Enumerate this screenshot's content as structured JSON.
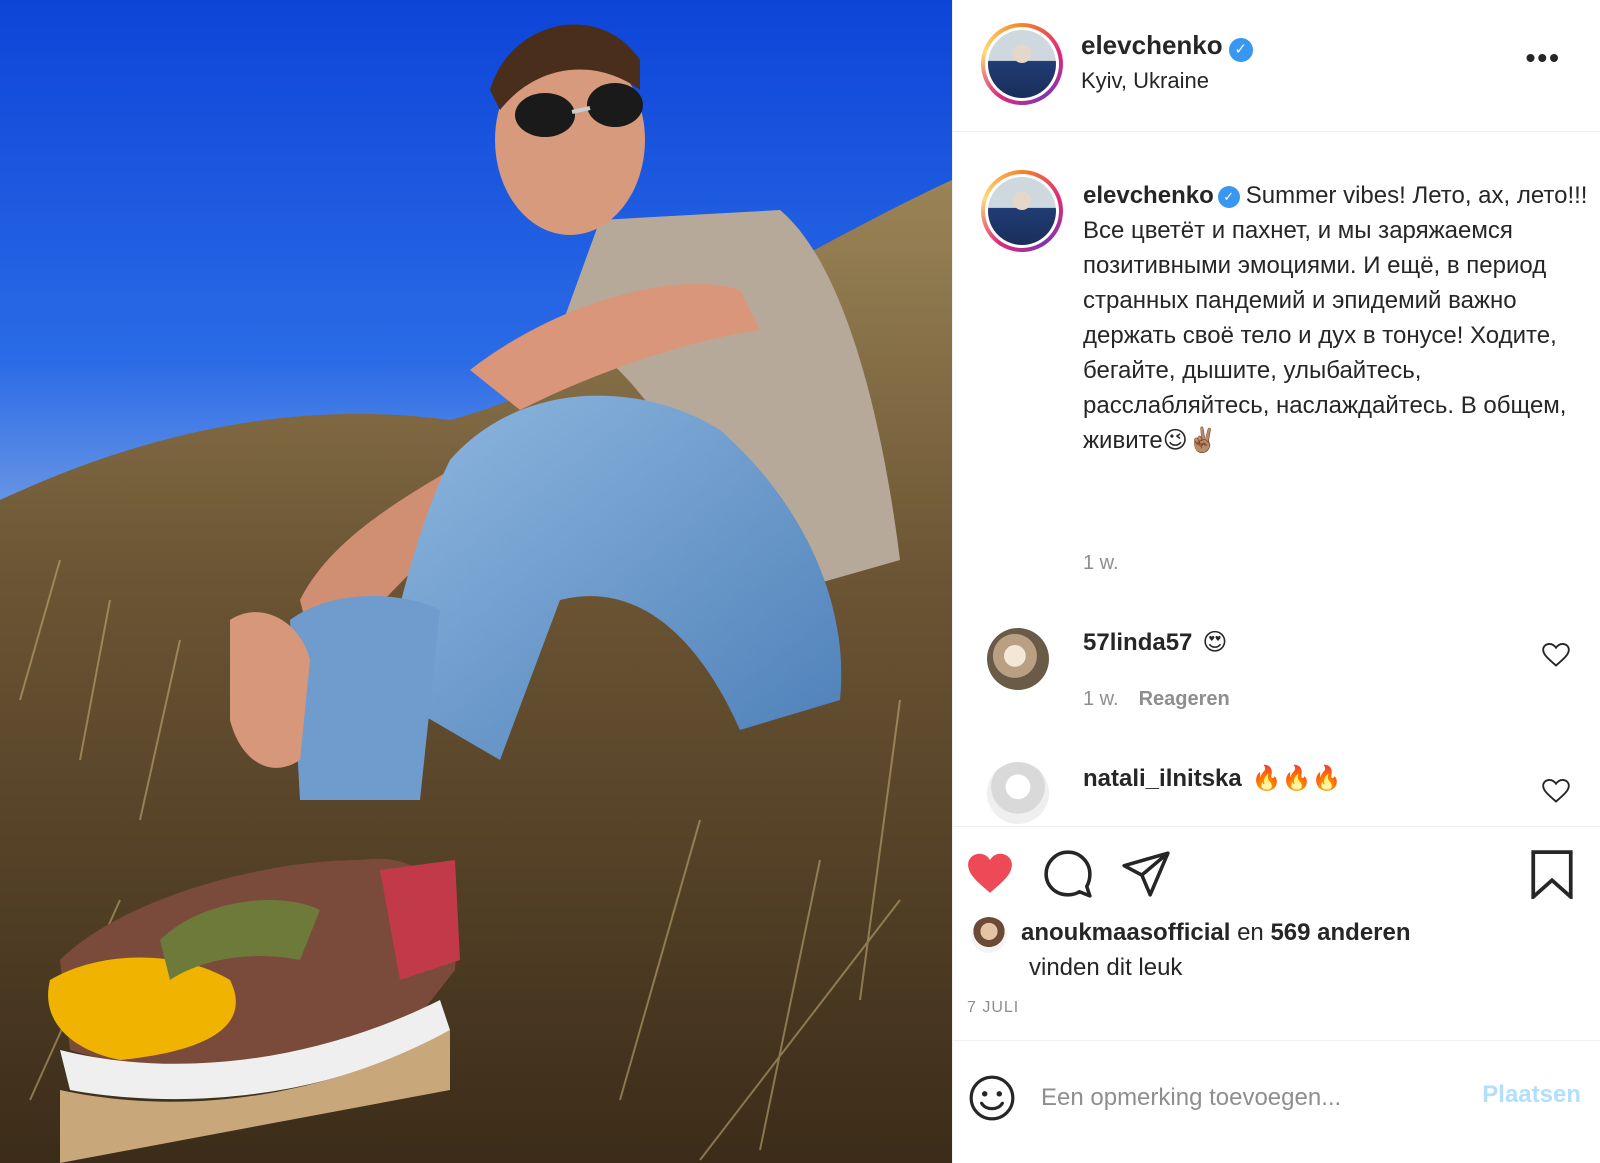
{
  "post": {
    "photo_icon": "photo-image",
    "account": {
      "username": "elevchenko",
      "verified_icon": "verified-badge-icon",
      "location": "Kyiv, Ukraine",
      "more_icon": "more-options-icon"
    },
    "caption": {
      "username": "elevchenko",
      "text": "Summer vibes! Лето, ах, лето!!! Все цветёт и пахнет, и мы заряжаемся позитивными эмоциями. И ещё, в период странных пандемий и эпидемий важно держать своё тело и дух в тонусе! Ходите, бегайте, дышите, улыбайтесь, расслабляйтесь, наслаждайтесь. В общем, живите😉✌🏽",
      "time": "1 w."
    },
    "comments": [
      {
        "username": "57linda57",
        "text": "😍",
        "time": "1 w.",
        "reply_label": "Reageren"
      },
      {
        "username": "natali_ilnitska",
        "text": "🔥🔥🔥"
      }
    ],
    "actions": {
      "like_icon": "heart-filled-icon",
      "comment_icon": "comment-icon",
      "share_icon": "share-icon",
      "save_icon": "bookmark-icon",
      "like_color": "#ed4956"
    },
    "likes": {
      "liker": "anoukmaasofficial",
      "connector": "en",
      "others": "569 anderen",
      "suffix": "vinden dit leuk"
    },
    "date": "7 JULI",
    "add_comment": {
      "placeholder": "Een opmerking toevoegen...",
      "post_label": "Plaatsen",
      "emoji_icon": "emoji-icon"
    }
  }
}
